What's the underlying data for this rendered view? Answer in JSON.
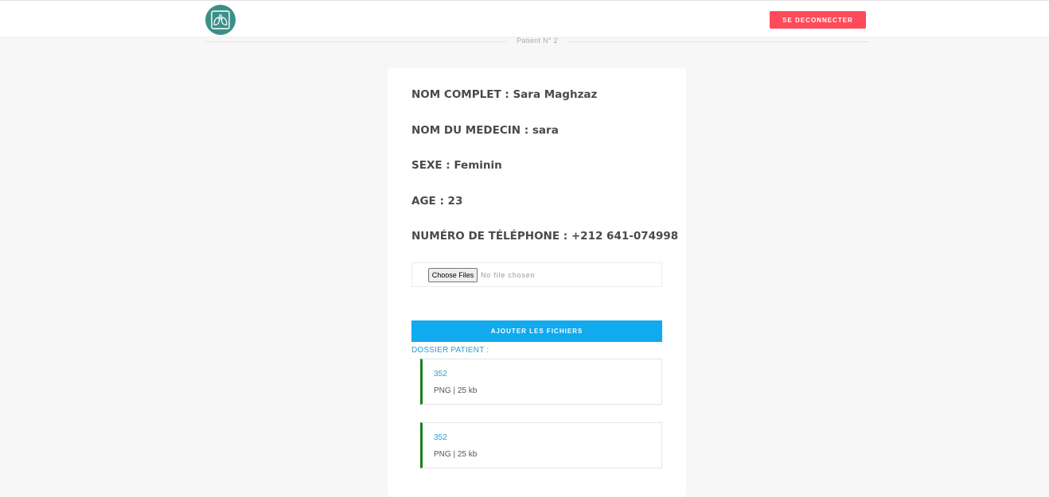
{
  "header": {
    "logo_icon": "lungs-logo-icon",
    "logout_label": "SE DECONNECTER",
    "colors": {
      "logout_bg": "#ff4a5a",
      "logo_bg": "#3a9088"
    }
  },
  "section": {
    "title": "Patient N° 2"
  },
  "patient": {
    "fullname": "NOM COMPLET : Sara Maghzaz",
    "doctor": "NOM DU MEDECIN : sara",
    "sex": "SEXE : Feminin",
    "age": "AGE : 23",
    "phone": "NUMÉRO DE TÉLÉPHONE : +212 641-074998"
  },
  "upload": {
    "choose_label": "Choose Files",
    "status": "No file chosen",
    "submit_label": "AJOUTER LES FICHIERS",
    "colors": {
      "submit_bg": "#12aaee"
    }
  },
  "dossier": {
    "label": "DOSSIER PATIENT :",
    "files": [
      {
        "name": "352",
        "meta": "PNG | 25 kb"
      },
      {
        "name": "352",
        "meta": "PNG | 25 kb"
      }
    ],
    "colors": {
      "accent": "#1a7f1a",
      "link": "#2b9cd8"
    }
  }
}
